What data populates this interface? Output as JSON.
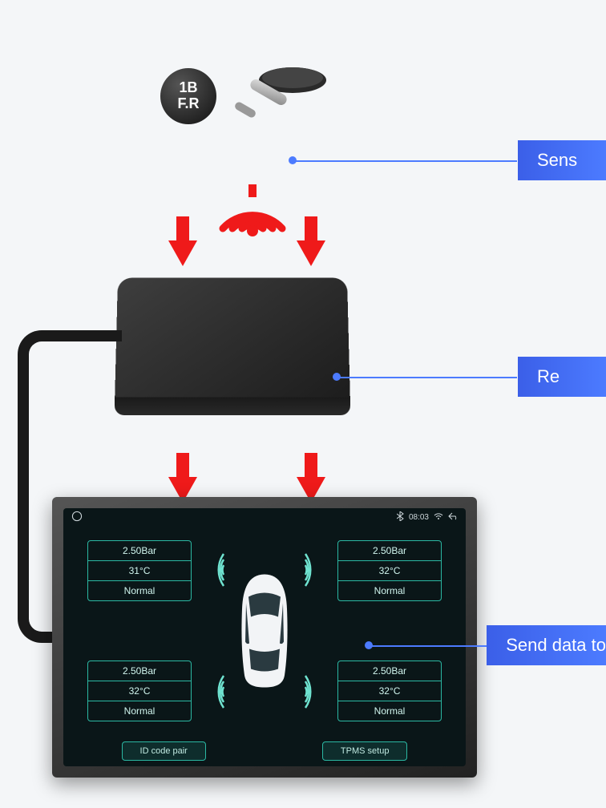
{
  "sensors": {
    "cap_line1": "1B",
    "cap_line2": "F.R"
  },
  "labels": {
    "sensors": "Sens",
    "receiver": "Re",
    "display": "Send data to"
  },
  "display": {
    "statusbar": {
      "time": "08:03"
    },
    "tires": {
      "fl": {
        "pressure": "2.50Bar",
        "temp": "31°C",
        "status": "Normal"
      },
      "fr": {
        "pressure": "2.50Bar",
        "temp": "32°C",
        "status": "Normal"
      },
      "rl": {
        "pressure": "2.50Bar",
        "temp": "32°C",
        "status": "Normal"
      },
      "rr": {
        "pressure": "2.50Bar",
        "temp": "32°C",
        "status": "Normal"
      }
    },
    "buttons": {
      "pair": "ID code pair",
      "setup": "TPMS setup"
    }
  }
}
